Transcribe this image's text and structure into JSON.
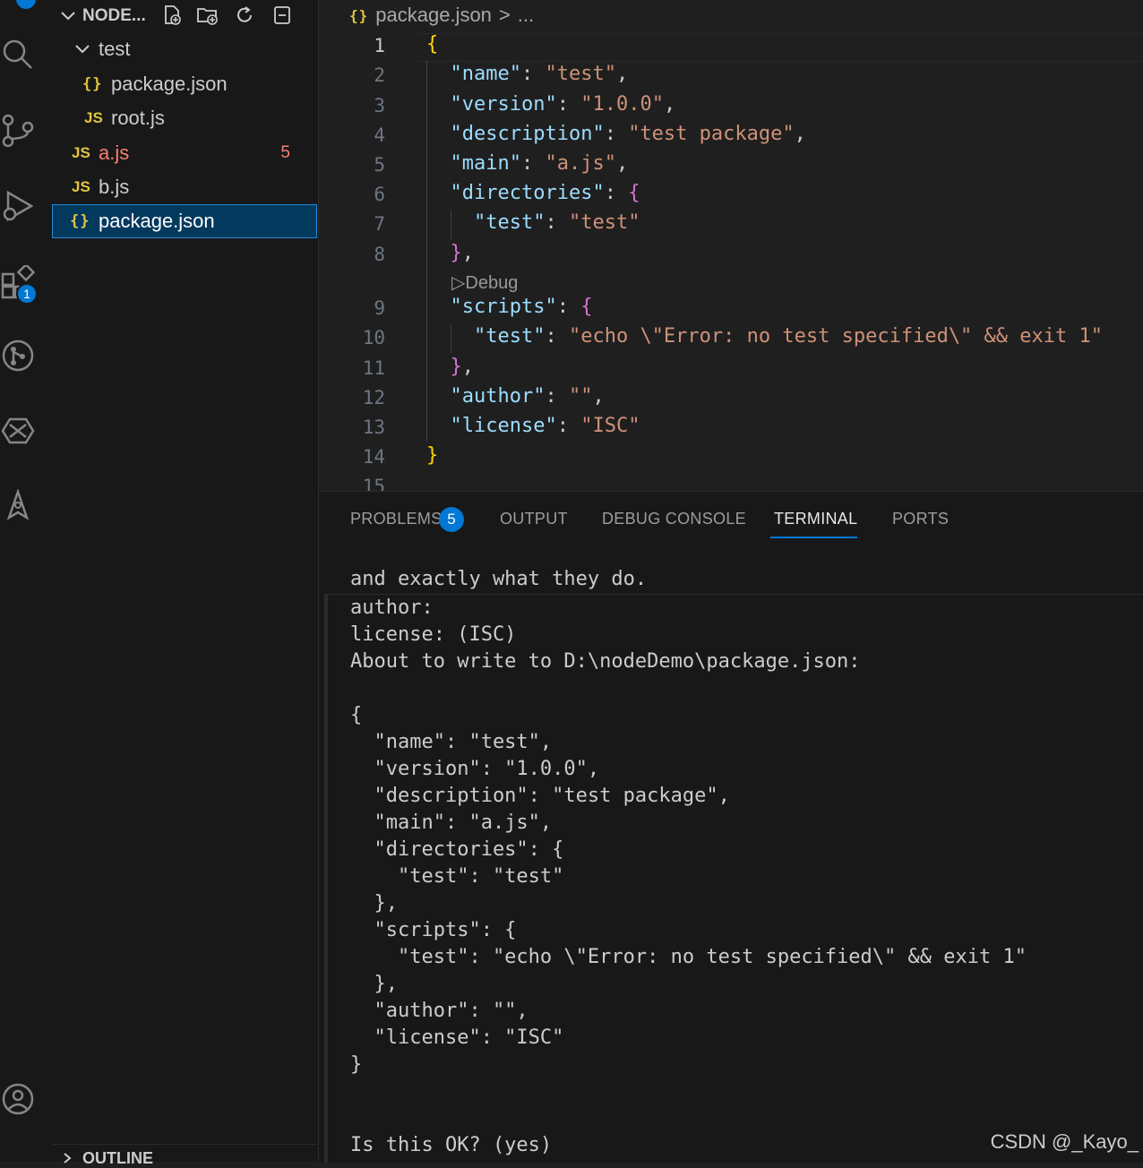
{
  "activity_bar": {
    "extensions_badge": "1"
  },
  "explorer": {
    "title": "NODE...",
    "tree": [
      {
        "label": "test",
        "type": "folder",
        "icon": "chevron-down-icon"
      },
      {
        "label": "package.json",
        "icon_text": "{}",
        "type": "json"
      },
      {
        "label": "root.js",
        "icon_text": "JS",
        "type": "js"
      },
      {
        "label": "a.js",
        "icon_text": "JS",
        "type": "js",
        "problems": "5"
      },
      {
        "label": "b.js",
        "icon_text": "JS",
        "type": "js"
      },
      {
        "label": "package.json",
        "icon_text": "{}",
        "type": "json",
        "selected": true
      }
    ],
    "outline_title": "OUTLINE"
  },
  "editor": {
    "breadcrumb_icon": "{}",
    "breadcrumb_file": "package.json",
    "breadcrumb_sep": ">",
    "breadcrumb_more": "...",
    "line_numbers": [
      "1",
      "2",
      "3",
      "4",
      "5",
      "6",
      "7",
      "8",
      "9",
      "10",
      "11",
      "12",
      "13",
      "14",
      "15"
    ],
    "debug_lens": "Debug",
    "code": {
      "l1": "{",
      "name_k": "\"name\"",
      "name_v": "\"test\"",
      "version_k": "\"version\"",
      "version_v": "\"1.0.0\"",
      "description_k": "\"description\"",
      "description_v": "\"test package\"",
      "main_k": "\"main\"",
      "main_v": "\"a.js\"",
      "directories_k": "\"directories\"",
      "dir_test_k": "\"test\"",
      "dir_test_v": "\"test\"",
      "scripts_k": "\"scripts\"",
      "scr_test_k": "\"test\"",
      "scr_test_v": "\"echo \\\"Error: no test specified\\\" && exit 1\"",
      "author_k": "\"author\"",
      "author_v": "\"\"",
      "license_k": "\"license\"",
      "license_v": "\"ISC\"",
      "l14": "}"
    }
  },
  "panel": {
    "tabs": [
      "PROBLEMS",
      "OUTPUT",
      "DEBUG CONSOLE",
      "TERMINAL",
      "PORTS"
    ],
    "problems_badge": "5",
    "active_tab": "TERMINAL",
    "terminal_lines": [
      "and exactly what they do.",
      "author:",
      "license: (ISC)",
      "About to write to D:\\nodeDemo\\package.json:",
      "",
      "{",
      "  \"name\": \"test\",",
      "  \"version\": \"1.0.0\",",
      "  \"description\": \"test package\",",
      "  \"main\": \"a.js\",",
      "  \"directories\": {",
      "    \"test\": \"test\"",
      "  },",
      "  \"scripts\": {",
      "    \"test\": \"echo \\\"Error: no test specified\\\" && exit 1\"",
      "  },",
      "  \"author\": \"\",",
      "  \"license\": \"ISC\"",
      "}",
      "",
      "",
      "Is this OK? (yes)"
    ]
  },
  "watermark": "CSDN @_Kayo_"
}
